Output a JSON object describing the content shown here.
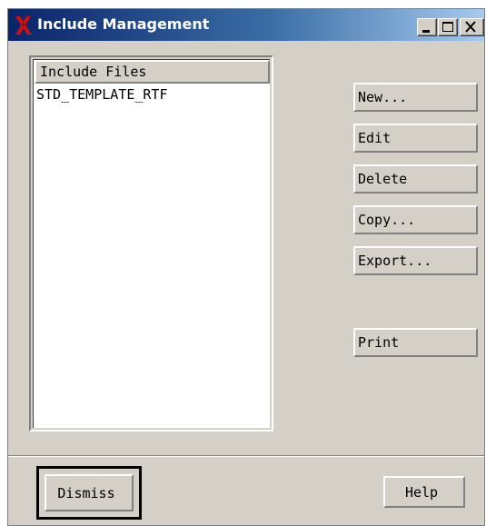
{
  "window": {
    "title": "Include Management",
    "icon": "x-window-system-icon",
    "controls": {
      "minimize": "minimize-icon",
      "maximize": "maximize-icon",
      "close": "close-icon"
    }
  },
  "list": {
    "header": "Include Files",
    "items": [
      "STD_TEMPLATE_RTF"
    ]
  },
  "actions": {
    "new": "New...",
    "edit": "Edit",
    "delete": "Delete",
    "copy": "Copy...",
    "export": "Export...",
    "print": "Print"
  },
  "footer": {
    "dismiss": "Dismiss",
    "help": "Help"
  },
  "colors": {
    "title_bar_start": "#0a246a",
    "title_bar_end": "#a6caf0",
    "window_face": "#d4d0c8",
    "list_background": "#ffffff",
    "x_icon": "#cc1111"
  }
}
